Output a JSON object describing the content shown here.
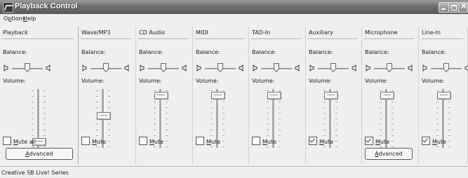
{
  "window": {
    "title": "Playback Control",
    "menu": [
      {
        "label": "Options",
        "accel": "p"
      },
      {
        "label": "Help",
        "accel": "H"
      }
    ],
    "status": "Creative SB Live! Series"
  },
  "labels": {
    "balance": "Balance:",
    "volume": "Volume:",
    "mute_all": "Mute all",
    "mute": "Mute",
    "advanced": "Advanced"
  },
  "channels": [
    {
      "name": "Playback",
      "balance": 0.5,
      "volume": 0.05,
      "muted": false,
      "mute_label": "Mute all",
      "advanced": true
    },
    {
      "name": "Wave/MP3",
      "balance": 0.5,
      "volume": 0.55,
      "muted": false,
      "mute_label": "Mute",
      "advanced": false
    },
    {
      "name": "CD Audio",
      "balance": 0.5,
      "volume": 0.95,
      "muted": false,
      "mute_label": "Mute",
      "advanced": false
    },
    {
      "name": "MIDI",
      "balance": 0.5,
      "volume": 0.95,
      "muted": false,
      "mute_label": "Mute",
      "advanced": false
    },
    {
      "name": "TAD-In",
      "balance": 0.5,
      "volume": 0.95,
      "muted": false,
      "mute_label": "Mute",
      "advanced": false
    },
    {
      "name": "Auxiliary",
      "balance": 0.5,
      "volume": 0.95,
      "muted": true,
      "mute_label": "Mute",
      "advanced": false
    },
    {
      "name": "Microphone",
      "balance": 0.5,
      "volume": 0.95,
      "muted": true,
      "mute_label": "Mute",
      "advanced": true
    },
    {
      "name": "Line-In",
      "balance": 0.5,
      "volume": 0.95,
      "muted": true,
      "mute_label": "Mute",
      "advanced": false
    }
  ]
}
